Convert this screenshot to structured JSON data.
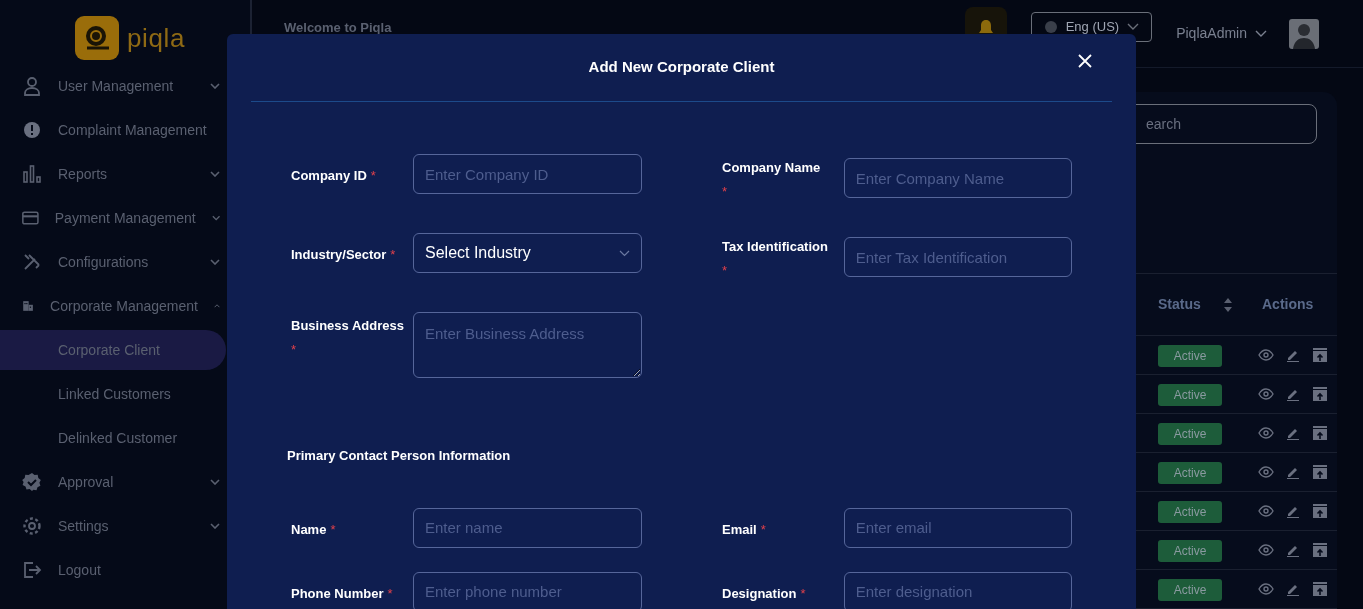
{
  "brand": {
    "name": "piqla"
  },
  "sidebar": {
    "items": [
      {
        "label": "User Management",
        "kind": "group",
        "expanded": false
      },
      {
        "label": "Complaint Management",
        "kind": "link"
      },
      {
        "label": "Reports",
        "kind": "group",
        "expanded": false
      },
      {
        "label": "Payment Management",
        "kind": "group",
        "expanded": false
      },
      {
        "label": "Configurations",
        "kind": "group",
        "expanded": false
      },
      {
        "label": "Corporate Management",
        "kind": "group",
        "expanded": true,
        "children": [
          {
            "label": "Corporate Client",
            "selected": true
          },
          {
            "label": "Linked Customers",
            "selected": false
          },
          {
            "label": "Delinked Customer",
            "selected": false
          }
        ]
      },
      {
        "label": "Approval",
        "kind": "group",
        "expanded": false
      },
      {
        "label": "Settings",
        "kind": "group",
        "expanded": false
      },
      {
        "label": "Logout",
        "kind": "link"
      }
    ]
  },
  "header": {
    "welcome": "Welcome to Piqla",
    "language": "Eng (US)",
    "user": "PiqlaAdmin"
  },
  "search": {
    "placeholder": "earch"
  },
  "table": {
    "columns": [
      "Status",
      "Actions"
    ],
    "rows": [
      {
        "status": "Active"
      },
      {
        "status": "Active"
      },
      {
        "status": "Active"
      },
      {
        "status": "Active"
      },
      {
        "status": "Active"
      },
      {
        "status": "Active"
      },
      {
        "status": "Active"
      }
    ]
  },
  "modal": {
    "title": "Add New Corporate Client",
    "fields": [
      {
        "label": "Company ID",
        "required_mark": "*",
        "kind": "text",
        "placeholder": "Enter Company ID"
      },
      {
        "label": "Company Name",
        "required_mark": "*",
        "kind": "text",
        "placeholder": "Enter Company Name"
      },
      {
        "label": "Industry/Sector",
        "required_mark": "*",
        "kind": "select",
        "value": "Select Industry"
      },
      {
        "label": "Tax Identification",
        "required_mark": "*",
        "kind": "text",
        "placeholder": "Enter Tax Identification"
      },
      {
        "label": "Business Address",
        "required_mark": "*",
        "kind": "textarea",
        "placeholder": "Enter Business Address"
      }
    ],
    "section_title": "Primary Contact Person Information",
    "contact_fields": [
      {
        "label": "Name",
        "required_mark": "*",
        "placeholder": "Enter name"
      },
      {
        "label": "Email",
        "required_mark": "*",
        "placeholder": "Enter email"
      },
      {
        "label": "Phone Number",
        "required_mark": "*",
        "placeholder": "Enter phone number"
      },
      {
        "label": "Designation",
        "required_mark": "*",
        "placeholder": "Enter designation"
      }
    ]
  }
}
